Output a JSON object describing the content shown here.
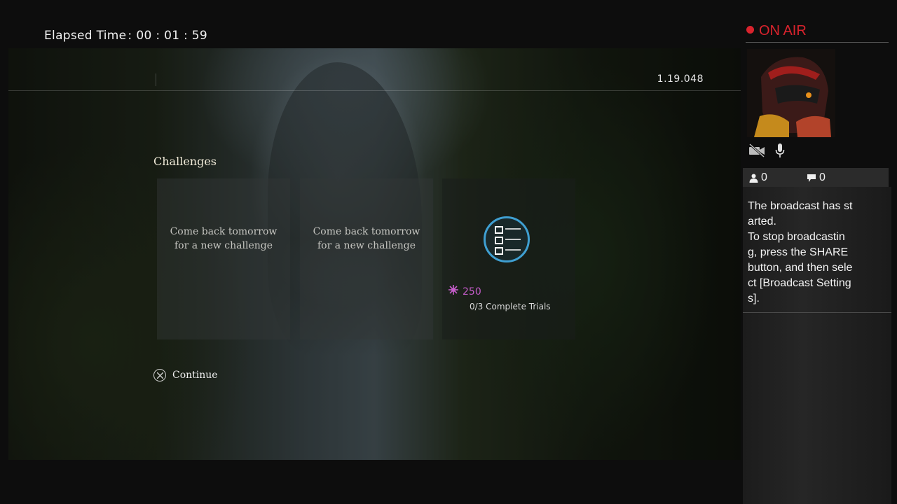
{
  "broadcast": {
    "elapsed_label": "Elapsed Time",
    "elapsed_sep": ":",
    "elapsed_value": "00 : 01 : 59",
    "on_air": "ON AIR",
    "on_air_color": "#d9232d",
    "viewers": "0",
    "comments": "0",
    "message": "The broadcast has started.\nTo stop broadcasting, press the SHARE button, and then select [Broadcast Settings]."
  },
  "game": {
    "version": "1.19.048",
    "section_title": "Challenges",
    "cards": [
      {
        "message_line1": "Come back tomorrow",
        "message_line2": "for a new challenge"
      },
      {
        "message_line1": "Come back tomorrow",
        "message_line2": "for a new challenge"
      },
      {
        "reward": "250",
        "progress": "0/3 Complete Trials",
        "icon": "checklist-icon",
        "icon_color": "#3f9fd1",
        "reward_color": "#c45cc9"
      }
    ],
    "continue_label": "Continue",
    "continue_icon": "cross-button-icon"
  }
}
